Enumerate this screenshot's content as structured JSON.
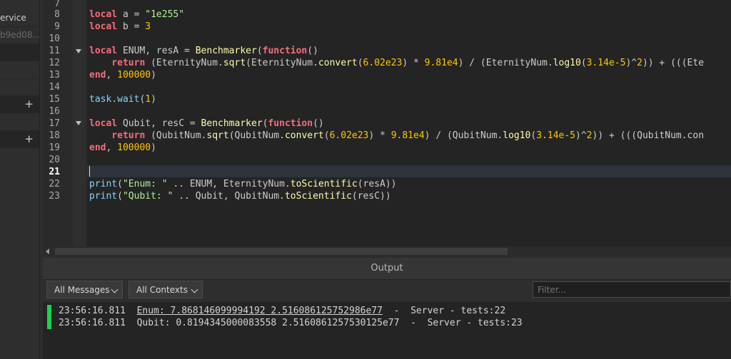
{
  "explorer": {
    "rows": [
      "ervice",
      "b9ed08..."
    ],
    "plus_icon": "+"
  },
  "editor": {
    "line_numbers": [
      "7",
      "8",
      "9",
      "10",
      "11",
      "12",
      "13",
      "14",
      "15",
      "16",
      "17",
      "18",
      "19",
      "20",
      "21",
      "22",
      "23"
    ],
    "active_line": "21",
    "lines": {
      "l8": {
        "kw": "local",
        "rest": " a = ",
        "str": "\"1e255\""
      },
      "l9": {
        "kw": "local",
        "rest": " b = ",
        "num": "3"
      },
      "l11": {
        "kw": "local",
        "rest": " ENUM, resA = ",
        "fn": "Benchmarker",
        "p1": "(",
        "kw2": "function",
        "p2": "()"
      },
      "l12": {
        "kw": "return",
        "a": " (EternityNum.",
        "f1": "sqrt",
        "b": "(EternityNum.",
        "f2": "convert",
        "c": "(",
        "n1": "6.02e23",
        "d": ") * ",
        "n2": "9.81e4",
        "e": ") / (EternityNum.",
        "f3": "log10",
        "g": "(",
        "n3": "3.14e-5",
        "h": ")^",
        "n4": "2",
        "i": ")) + (((Ete"
      },
      "l13": {
        "kw": "end",
        "rest": ", ",
        "num": "100000",
        "close": ")"
      },
      "l15": {
        "bi": "task",
        "dot": ".",
        "fn": "wait",
        "p": "(",
        "num": "1",
        "close": ")"
      },
      "l17": {
        "kw": "local",
        "rest": " Qubit, resC = ",
        "fn": "Benchmarker",
        "p1": "(",
        "kw2": "function",
        "p2": "()"
      },
      "l18": {
        "kw": "return",
        "a": " (QubitNum.",
        "f1": "sqrt",
        "b": "(QubitNum.",
        "f2": "convert",
        "c": "(",
        "n1": "6.02e23",
        "d": ") * ",
        "n2": "9.81e4",
        "e": ") / (QubitNum.",
        "f3": "log10",
        "g": "(",
        "n3": "3.14e-5",
        "h": ")^",
        "n4": "2",
        "i": ")) + (((QubitNum.con"
      },
      "l19": {
        "kw": "end",
        "rest": ", ",
        "num": "100000",
        "close": ")"
      },
      "l22": {
        "bi": "print",
        "p": "(",
        "str": "\"Enum: \"",
        "a": " .. ENUM, EternityNum.",
        "fn": "toScientific",
        "b": "(resA))"
      },
      "l23": {
        "bi": "print",
        "p": "(",
        "str": "\"Qubit: \"",
        "a": " .. Qubit, QubitNum.",
        "fn": "toScientific",
        "b": "(resC))"
      }
    }
  },
  "output": {
    "title": "Output",
    "messages_filter": "All Messages",
    "contexts_filter": "All Contexts",
    "filter_placeholder": "Filter...",
    "messages": [
      {
        "time": "23:56:16.811",
        "text": "Enum: 7.868146099994192 2.516086125752986e77",
        "sep": "  -  ",
        "source": "Server - tests:22"
      },
      {
        "time": "23:56:16.811",
        "text": "Qubit: 0.8194345000083558 2.5160861257530125e77",
        "sep": "  -  ",
        "source": "Server - tests:23"
      }
    ],
    "marker_color": "#19d44e"
  }
}
